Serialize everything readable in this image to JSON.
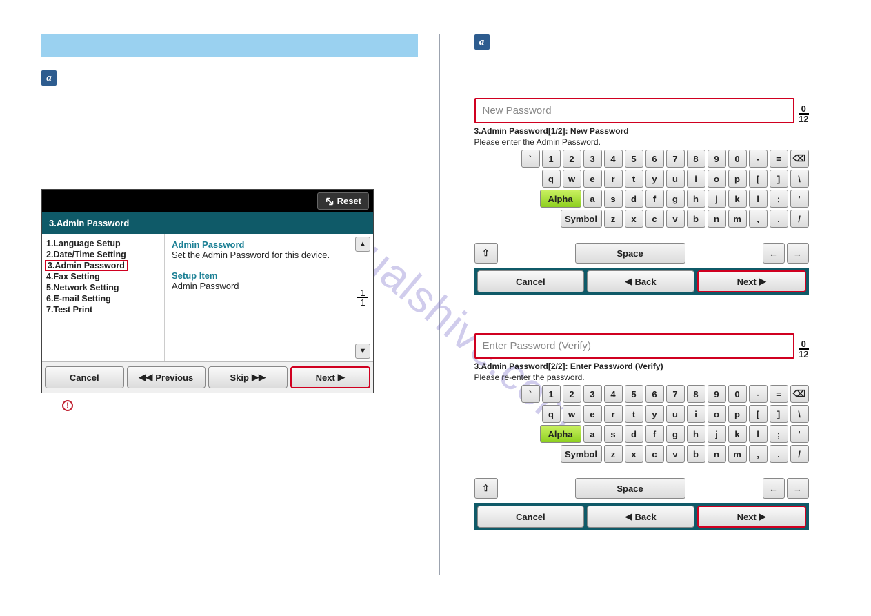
{
  "watermark": "manualshive.com",
  "left": {
    "wizard": {
      "reset": "Reset",
      "title": "3.Admin Password",
      "items": [
        "1.Language Setup",
        "2.Date/Time Setting",
        "3.Admin Password",
        "4.Fax Setting",
        "5.Network Setting",
        "6.E-mail Setting",
        "7.Test Print"
      ],
      "right": {
        "h1": "Admin Password",
        "t1": "Set the Admin Password for this device.",
        "h2": "Setup Item",
        "t2": "Admin Password"
      },
      "page_current": "1",
      "page_total": "1",
      "actions": {
        "cancel": "Cancel",
        "previous": "Previous",
        "skip": "Skip",
        "next": "Next"
      }
    }
  },
  "kb1": {
    "placeholder": "New Password",
    "count_cur": "0",
    "count_max": "12",
    "info": "3.Admin Password[1/2]: New Password",
    "sub": "Please enter the Admin Password.",
    "alpha": "Alpha",
    "symbol": "Symbol",
    "space": "Space",
    "cancel": "Cancel",
    "back": "Back",
    "next": "Next"
  },
  "kb2": {
    "placeholder": "Enter Password (Verify)",
    "count_cur": "0",
    "count_max": "12",
    "info": "3.Admin Password[2/2]: Enter Password (Verify)",
    "sub": "Please re-enter the password.",
    "alpha": "Alpha",
    "symbol": "Symbol",
    "space": "Space",
    "cancel": "Cancel",
    "back": "Back",
    "next": "Next"
  },
  "keys": {
    "row1": [
      "`",
      "1",
      "2",
      "3",
      "4",
      "5",
      "6",
      "7",
      "8",
      "9",
      "0",
      "-",
      "="
    ],
    "row2": [
      "q",
      "w",
      "e",
      "r",
      "t",
      "y",
      "u",
      "i",
      "o",
      "p",
      "[",
      "]",
      "\\"
    ],
    "row3": [
      "a",
      "s",
      "d",
      "f",
      "g",
      "h",
      "j",
      "k",
      "l",
      ";",
      "'"
    ],
    "row4": [
      "z",
      "x",
      "c",
      "v",
      "b",
      "n",
      "m",
      ",",
      ".",
      "/"
    ]
  }
}
